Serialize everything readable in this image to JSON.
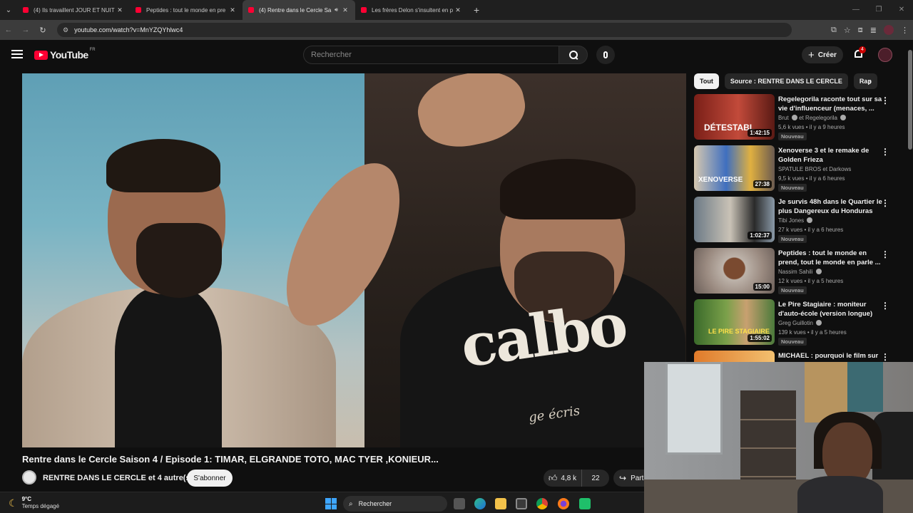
{
  "browser": {
    "tabs": [
      {
        "title": "(4) Ils travaillent JOUR ET NUIT",
        "active": false,
        "audio": false
      },
      {
        "title": "Peptides : tout le monde en pre",
        "active": false,
        "audio": false
      },
      {
        "title": "(4) Rentre dans le Cercle Sa",
        "active": true,
        "audio": true
      },
      {
        "title": "Les frères Delon s'insultent en p",
        "active": false,
        "audio": false
      }
    ],
    "url": "youtube.com/watch?v=MnYZQYhlwc4"
  },
  "header": {
    "logo_text": "YouTube",
    "country": "FR",
    "search_placeholder": "Rechercher",
    "create_label": "Créer",
    "notifications": "4"
  },
  "video": {
    "shirt_text": "calbo",
    "shirt_sub": "ge écris",
    "title": "Rentre dans le Cercle Saison 4 / Episode 1: TIMAR, ELGRANDE TOTO, MAC TYER ,KONIEUR...",
    "channel": "RENTRE DANS LE CERCLE et 4 autre(s)",
    "subscribe_label": "S'abonner",
    "likes": "4,8 k",
    "comments": "22",
    "share_label": "Part"
  },
  "chips": [
    "Tout",
    "Source : RENTRE DANS LE CERCLE",
    "Rap"
  ],
  "recommendations": [
    {
      "title": "Regelegorila raconte tout sur sa vie d'influenceur (menaces, ...",
      "channel": "Brut",
      "channel_extra": "et Regelegorila",
      "verified": true,
      "meta": "5,6 k vues • il y a 9 heures",
      "badge": "Nouveau",
      "duration": "1:42:15",
      "overlay": "DÉTESTABL",
      "thumb_color": "#b5342b"
    },
    {
      "title": "Xenoverse 3 et le remake de Golden Frieza",
      "channel": "SPATULE BROS et Darkows",
      "channel_extra": "",
      "verified": false,
      "meta": "9,5 k vues • il y a 6 heures",
      "badge": "Nouveau",
      "duration": "27:38",
      "overlay": "XENOVERSE",
      "thumb_color": "#3f6fbf"
    },
    {
      "title": "Je survis 48h dans le Quartier le plus Dangereux du Honduras",
      "channel": "Tibi Jones",
      "channel_extra": "",
      "verified": true,
      "meta": "27 k vues • il y a 6 heures",
      "badge": "Nouveau",
      "duration": "1:02:37",
      "overlay": "",
      "thumb_color": "#8a9aa8"
    },
    {
      "title": "Peptides : tout le monde en prend, tout le monde en parle ...",
      "channel": "Nassim Sahili",
      "channel_extra": "",
      "verified": true,
      "meta": "12 k vues • il y a 5 heures",
      "badge": "Nouveau",
      "duration": "15:00",
      "overlay": "",
      "thumb_color": "#9a8a80"
    },
    {
      "title": "Le Pire Stagiaire : moniteur d'auto-école (version longue)",
      "channel": "Greg Guillotin",
      "channel_extra": "",
      "verified": true,
      "meta": "139 k vues • il y a 5 heures",
      "badge": "Nouveau",
      "duration": "1:55:02",
      "overlay": "LE PIRE STAGIAIRE",
      "thumb_color": "#4a7a3a"
    },
    {
      "title": "MICHAEL : pourquoi le film sur",
      "channel": "",
      "channel_extra": "",
      "verified": false,
      "meta": "",
      "badge": "",
      "duration": "",
      "overlay": "",
      "thumb_color": "#e07a2a"
    }
  ],
  "taskbar": {
    "temp": "9°C",
    "weather": "Temps dégagé",
    "search_label": "Rechercher",
    "icons": [
      "task-view-icon",
      "edge-icon",
      "file-explorer-icon",
      "store-icon",
      "chrome-icon",
      "firefox-icon",
      "app-icon"
    ]
  },
  "colors": {
    "yt_red": "#ff0033",
    "background": "#0f0f0f",
    "chip_bg": "#272727"
  }
}
